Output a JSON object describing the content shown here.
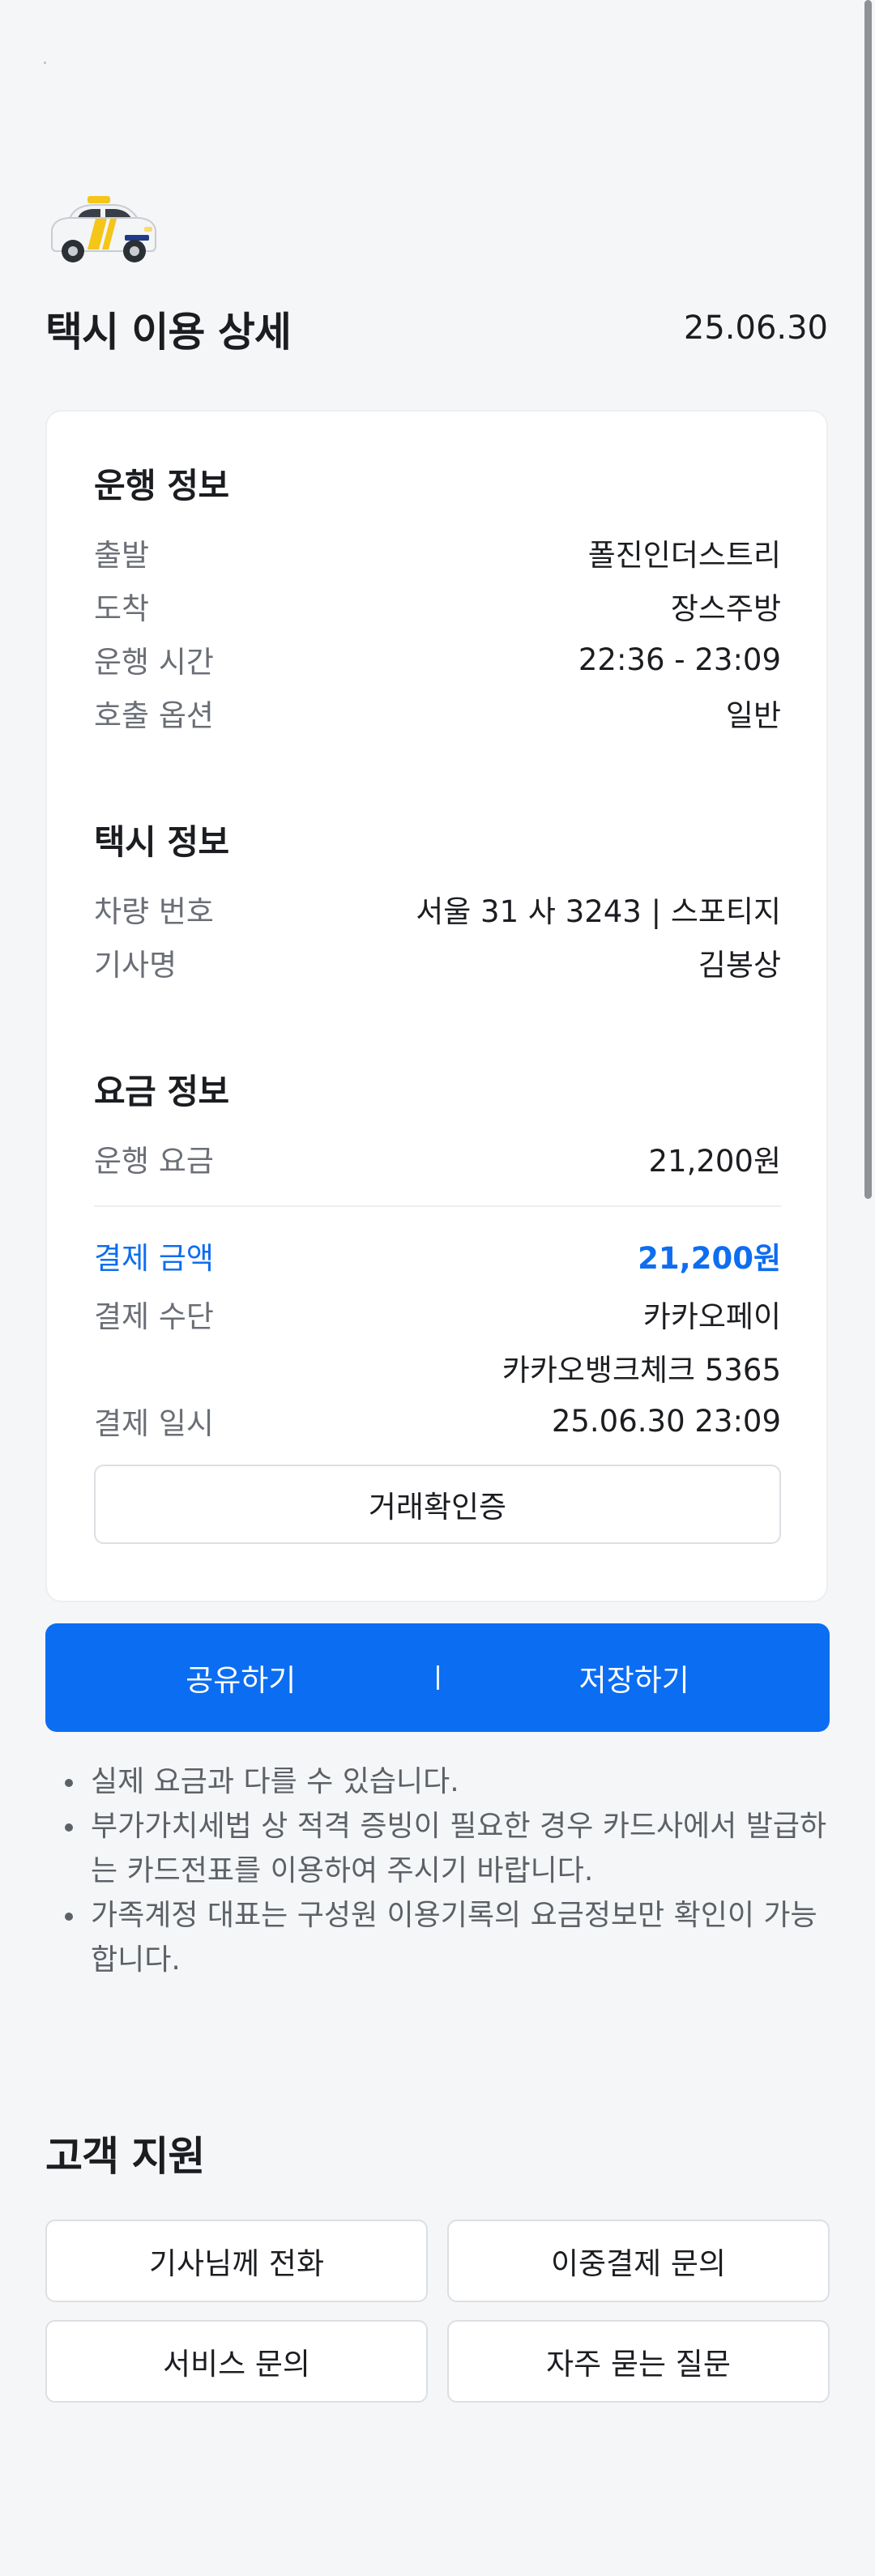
{
  "header": {
    "title": "택시 이용 상세",
    "date": "25.06.30",
    "icon": "taxi-icon"
  },
  "trip_info": {
    "title": "운행 정보",
    "rows": [
      {
        "label": "출발",
        "value": "폴진인더스트리"
      },
      {
        "label": "도착",
        "value": "장스주방"
      },
      {
        "label": "운행 시간",
        "value": "22:36 - 23:09"
      },
      {
        "label": "호출 옵션",
        "value": "일반"
      }
    ]
  },
  "taxi_info": {
    "title": "택시 정보",
    "rows": [
      {
        "label": "차량 번호",
        "value": "서울 31 사 3243 | 스포티지"
      },
      {
        "label": "기사명",
        "value": "김봉상"
      }
    ]
  },
  "fare_info": {
    "title": "요금 정보",
    "fare": {
      "label": "운행 요금",
      "value": "21,200원"
    },
    "paid": {
      "label": "결제 금액",
      "value": "21,200원"
    },
    "method": {
      "label": "결제 수단",
      "value": "카카오페이",
      "value2": "카카오뱅크체크 5365"
    },
    "paid_at": {
      "label": "결제 일시",
      "value": "25.06.30 23:09"
    },
    "receipt_button": "거래확인증"
  },
  "actions": {
    "share": "공유하기",
    "separator": "|",
    "save": "저장하기"
  },
  "notes": [
    "실제 요금과 다를 수 있습니다.",
    "부가가치세법 상 적격 증빙이 필요한 경우 카드사에서 발급하는 카드전표를 이용하여 주시기 바랍니다.",
    "가족계정 대표는 구성원 이용기록의 요금정보만 확인이 가능합니다."
  ],
  "support": {
    "title": "고객 지원",
    "buttons": [
      "기사님께 전화",
      "이중결제 문의",
      "서비스 문의",
      "자주 묻는 질문"
    ]
  },
  "colors": {
    "accent": "#0b6df2",
    "background": "#f5f6f7",
    "taxi_yellow": "#f5c518"
  }
}
